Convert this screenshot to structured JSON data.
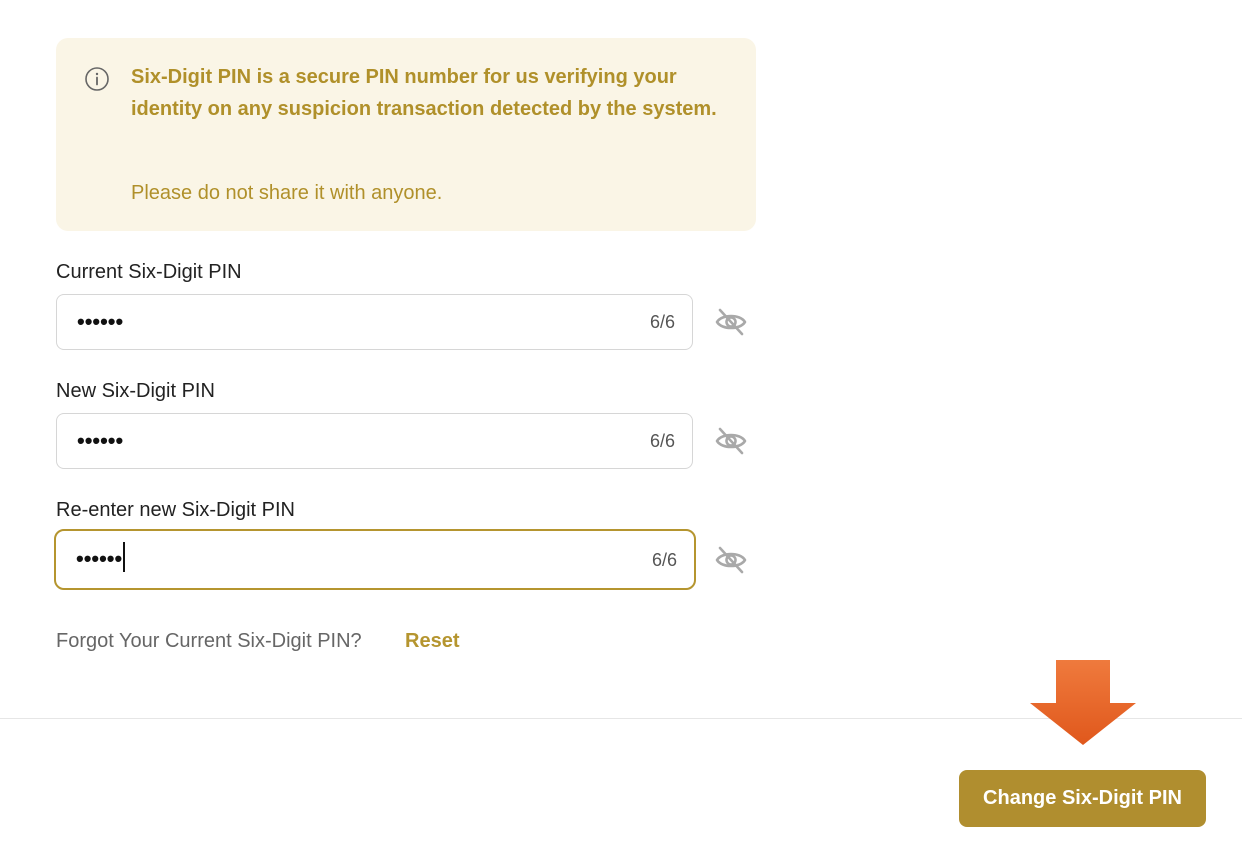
{
  "info": {
    "icon": "info-circle-icon",
    "message": "Six-Digit PIN is a secure PIN number for us verifying your identity on any suspicion transaction detected by the system.",
    "note": "Please do not share it with anyone.",
    "text_color": "#b0902a",
    "background_color": "#faf5e6"
  },
  "fields": [
    {
      "label": "Current Six-Digit PIN",
      "masked_value": "••••••",
      "counter": "6/6",
      "visibility_icon": "eye-off-icon"
    },
    {
      "label": "New Six-Digit PIN",
      "masked_value": "••••••",
      "counter": "6/6",
      "visibility_icon": "eye-off-icon"
    },
    {
      "label": "Re-enter new Six-Digit PIN",
      "masked_value": "••••••",
      "counter": "6/6",
      "visibility_icon": "eye-off-icon",
      "focused": true
    }
  ],
  "forgot": {
    "text": "Forgot Your Current Six-Digit PIN?",
    "link_label": "Reset"
  },
  "submit": {
    "label": "Change Six-Digit PIN"
  },
  "colors": {
    "accent": "#b5952f",
    "button": "#b08e2f",
    "annotation_arrow": "#e8692a"
  }
}
